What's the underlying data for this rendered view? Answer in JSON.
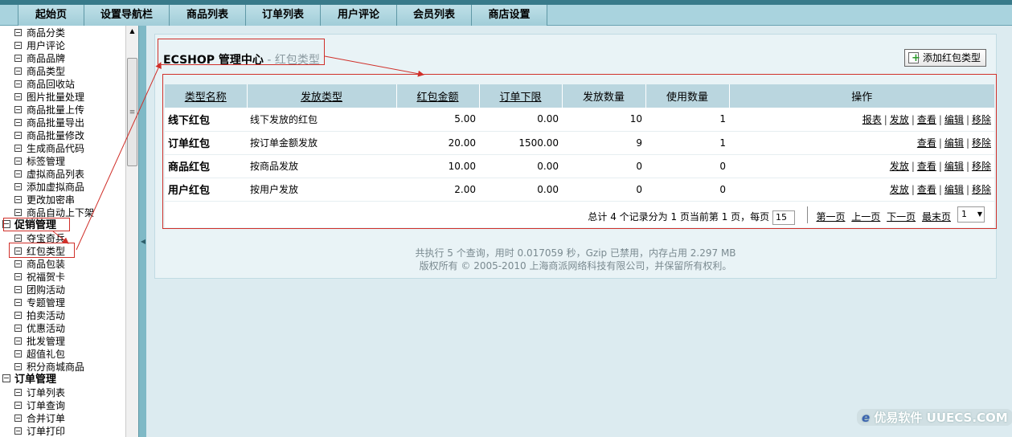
{
  "nav": {
    "tabs": [
      "起始页",
      "设置导航栏",
      "商品列表",
      "订单列表",
      "用户评论",
      "会员列表",
      "商店设置"
    ]
  },
  "sidebar": {
    "goods_items": [
      "商品分类",
      "用户评论",
      "商品品牌",
      "商品类型",
      "商品回收站",
      "图片批量处理",
      "商品批量上传",
      "商品批量导出",
      "商品批量修改",
      "生成商品代码",
      "标签管理",
      "虚拟商品列表",
      "添加虚拟商品",
      "更改加密串",
      "商品自动上下架"
    ],
    "promo_group": "促销管理",
    "promo_items": [
      "夺宝奇兵",
      "红包类型",
      "商品包装",
      "祝福贺卡",
      "团购活动",
      "专题管理",
      "拍卖活动",
      "优惠活动",
      "批发管理",
      "超值礼包",
      "积分商城商品"
    ],
    "order_group": "订单管理",
    "order_items": [
      "订单列表",
      "订单查询",
      "合并订单",
      "订单打印"
    ]
  },
  "page": {
    "title": "ECSHOP 管理中心",
    "subtitle": " - 红包类型",
    "add_button": "添加红包类型"
  },
  "table": {
    "headers": [
      "类型名称",
      "发放类型",
      "红包金额",
      "订单下限",
      "发放数量",
      "使用数量",
      "操作"
    ],
    "rows": [
      {
        "name": "线下红包",
        "type": "线下发放的红包",
        "amount": "5.00",
        "min": "0.00",
        "issued": "10",
        "used": "1",
        "ops": [
          "报表",
          "发放",
          "查看",
          "编辑",
          "移除"
        ]
      },
      {
        "name": "订单红包",
        "type": "按订单金额发放",
        "amount": "20.00",
        "min": "1500.00",
        "issued": "9",
        "used": "1",
        "ops": [
          "查看",
          "编辑",
          "移除"
        ]
      },
      {
        "name": "商品红包",
        "type": "按商品发放",
        "amount": "10.00",
        "min": "0.00",
        "issued": "0",
        "used": "0",
        "ops": [
          "发放",
          "查看",
          "编辑",
          "移除"
        ]
      },
      {
        "name": "用户红包",
        "type": "按用户发放",
        "amount": "2.00",
        "min": "0.00",
        "issued": "0",
        "used": "0",
        "ops": [
          "发放",
          "查看",
          "编辑",
          "移除"
        ]
      }
    ]
  },
  "pager": {
    "info": "总计  4 个记录分为  1 页当前第  1 页，每页",
    "per_page": "15",
    "first": "第一页",
    "prev": "上一页",
    "next": "下一页",
    "last": "最末页",
    "page_select": "1"
  },
  "footer": {
    "line1": "共执行  5 个查询，用时  0.017059 秒，Gzip 已禁用，内存占用  2.297 MB",
    "line2": "版权所有 © 2005-2010 上海商派网络科技有限公司，并保留所有权利。"
  },
  "watermark": {
    "logo": "e",
    "text": "优易软件 UUECS.COM"
  },
  "colors": {
    "annotation_red": "#d0302a",
    "nav_bg": "#a9d3de",
    "header_bg": "#bad6df"
  }
}
